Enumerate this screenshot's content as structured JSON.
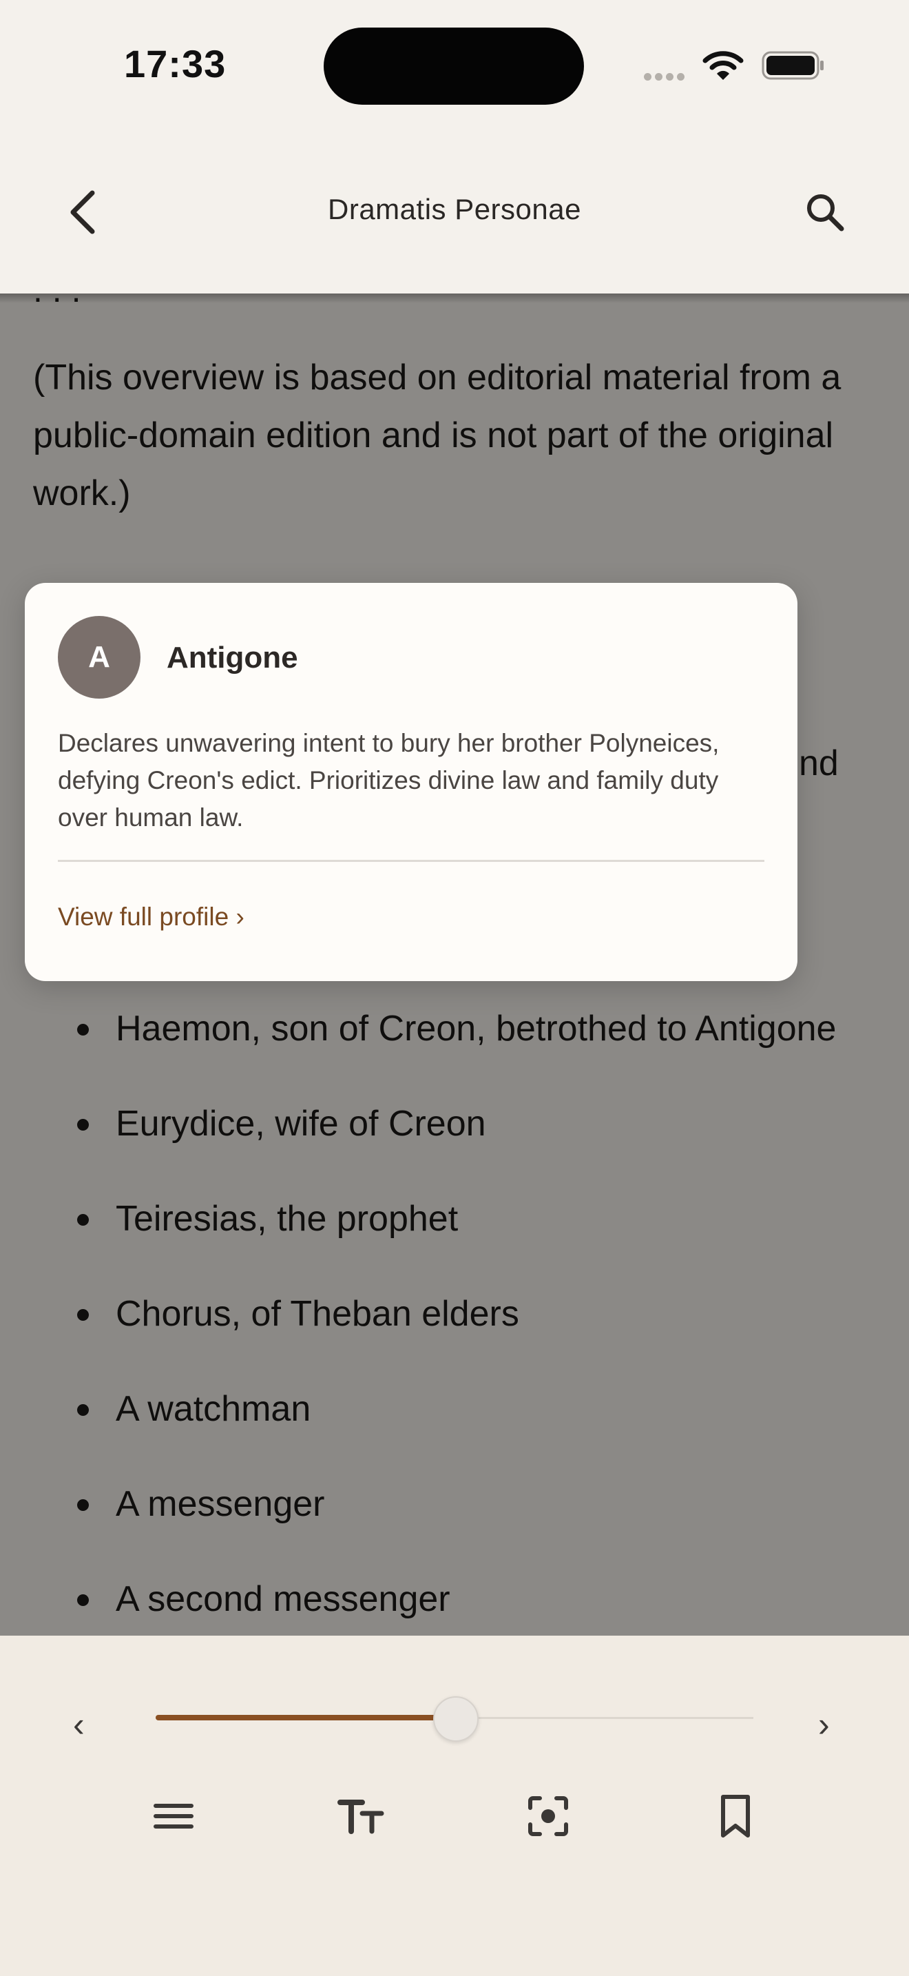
{
  "status_bar": {
    "time": "17:33"
  },
  "nav": {
    "title": "Dramatis Personae"
  },
  "content": {
    "note": "(This overview is based on editorial material from a public-domain edition and is not part of the original work.)",
    "obscured_fragment": "nd",
    "cast": [
      "Haemon, son of Creon, betrothed to Antigone",
      "Eurydice, wife of Creon",
      "Teiresias, the prophet",
      "Chorus, of Theban elders",
      "A watchman",
      "A messenger",
      "A second messenger"
    ]
  },
  "popover": {
    "avatar_initial": "A",
    "name": "Antigone",
    "description": "Declares unwavering intent to bury her brother Polyneices, defying Creon's edict. Prioritizes divine law and family duty over human law.",
    "link": "View full profile ›"
  },
  "toolbar": {
    "prev_label": "‹",
    "next_label": "›",
    "progress": 0.5,
    "accent_color": "#8a4f22",
    "icons": [
      "menu-icon",
      "text-size-icon",
      "focus-icon",
      "bookmark-icon"
    ]
  }
}
